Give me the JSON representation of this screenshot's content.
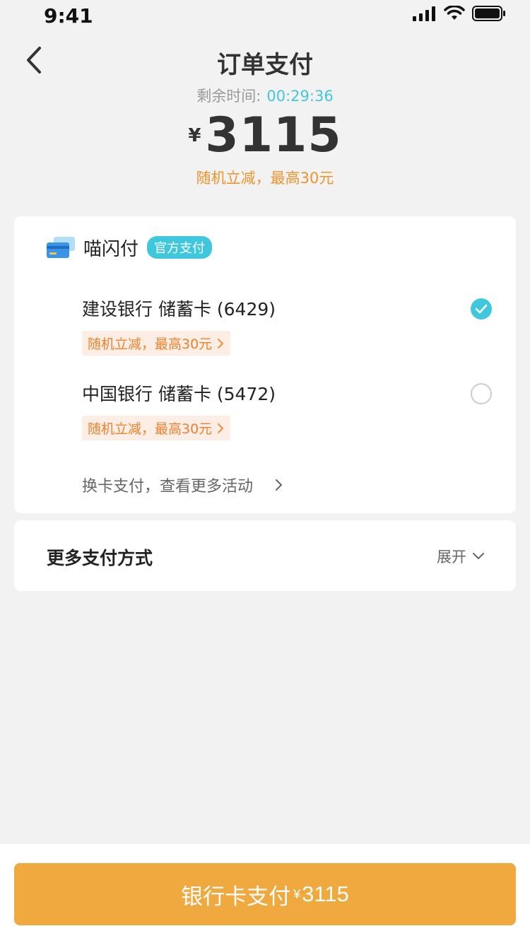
{
  "status": {
    "time": "9:41"
  },
  "nav": {
    "title": "订单支付",
    "back_icon": "chevron-left-icon"
  },
  "timer": {
    "label": "剩余时间:",
    "value": "00:29:36"
  },
  "amount": {
    "currency": "¥",
    "value": "3115"
  },
  "promo_top": "随机立减，最高30元",
  "colors": {
    "accent": "#3fc8dd",
    "promo": "#f0932b",
    "button": "#efa93e",
    "background": "#f2f2f2"
  },
  "brand": {
    "name": "喵闪付",
    "badge": "官方支付",
    "icon": "card-icon"
  },
  "banks": [
    {
      "name": "建设银行 储蓄卡 (6429)",
      "promo": "随机立减，最高30元",
      "selected": true
    },
    {
      "name": "中国银行 储蓄卡 (5472)",
      "promo": "随机立减，最高30元",
      "selected": false
    }
  ],
  "switch_card": "换卡支付，查看更多活动",
  "more_methods": {
    "label": "更多支付方式",
    "expand": "展开"
  },
  "pay_button": {
    "label": "银行卡支付",
    "currency": "¥",
    "amount": "3115"
  }
}
